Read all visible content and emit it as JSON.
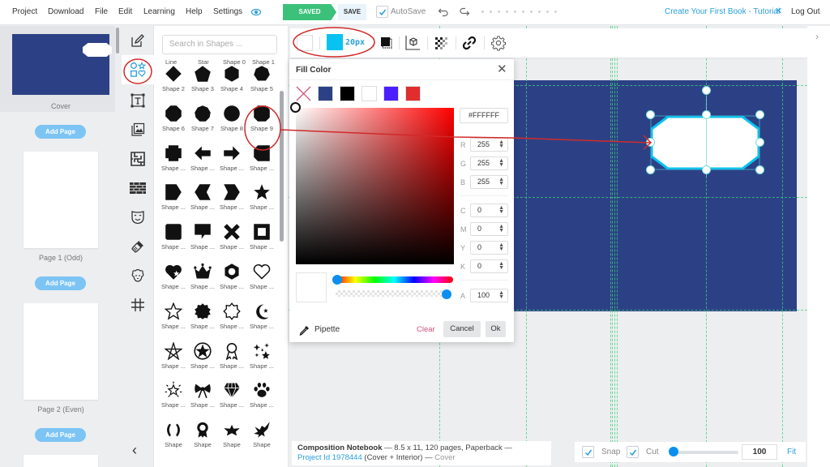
{
  "menu": {
    "items": [
      "Project",
      "Download",
      "File",
      "Edit",
      "Learning",
      "Help",
      "Settings"
    ],
    "saved_label": "SAVED",
    "save_label": "SAVE",
    "autosave_label": "AutoSave",
    "autosave_checked": true,
    "tutorial_label": "Create Your First Book - Tutorial",
    "logout_label": "Log Out"
  },
  "pages": {
    "items": [
      {
        "label": "Cover",
        "selected": true
      },
      {
        "label": "Page 1 (Odd)"
      },
      {
        "label": "Page 2 (Even)"
      }
    ],
    "add_page_label": "Add Page"
  },
  "tools": {
    "items": [
      "edit-icon",
      "shapes-icon",
      "text-icon",
      "images-icon",
      "puzzles-icon",
      "patterns-icon",
      "masks-icon",
      "brush-icon",
      "sheep-icon",
      "grid-icon"
    ],
    "active": "shapes-icon"
  },
  "shapes_panel": {
    "search_placeholder": "Search in Shapes ...",
    "partial_top_labels": [
      "Line",
      "Star",
      "Shape 0",
      "Shape 1"
    ],
    "items": [
      {
        "label": "Shape 2",
        "icon": "diamond"
      },
      {
        "label": "Shape 3",
        "icon": "pentagon"
      },
      {
        "label": "Shape 4",
        "icon": "hexagon"
      },
      {
        "label": "Shape 5",
        "icon": "heptagon"
      },
      {
        "label": "Shape 6",
        "icon": "octagon"
      },
      {
        "label": "Shape 7",
        "icon": "nonagon"
      },
      {
        "label": "Shape 8",
        "icon": "decagon"
      },
      {
        "label": "Shape 9",
        "icon": "rounded-octagon",
        "highlighted": true
      },
      {
        "label": "Shape ...",
        "icon": "cross-square"
      },
      {
        "label": "Shape ...",
        "icon": "arrow-left"
      },
      {
        "label": "Shape ...",
        "icon": "arrow-right"
      },
      {
        "label": "Shape ...",
        "icon": "cut-rect-left"
      },
      {
        "label": "Shape ...",
        "icon": "tag-right"
      },
      {
        "label": "Shape ...",
        "icon": "chevron-left"
      },
      {
        "label": "Shape ...",
        "icon": "chevron-right"
      },
      {
        "label": "Shape ...",
        "icon": "star-solid"
      },
      {
        "label": "Shape ...",
        "icon": "rounded-square"
      },
      {
        "label": "Shape ...",
        "icon": "speech-bubble"
      },
      {
        "label": "Shape ...",
        "icon": "x-cross"
      },
      {
        "label": "Shape ...",
        "icon": "square-frame"
      },
      {
        "label": "Shape ...",
        "icon": "heart-star"
      },
      {
        "label": "Shape ...",
        "icon": "crown"
      },
      {
        "label": "Shape ...",
        "icon": "hex-nut"
      },
      {
        "label": "Shape ...",
        "icon": "heart-outline"
      },
      {
        "label": "Shape ...",
        "icon": "star-outline"
      },
      {
        "label": "Shape ...",
        "icon": "seal"
      },
      {
        "label": "Shape ...",
        "icon": "seal-outline"
      },
      {
        "label": "Shape ...",
        "icon": "crescent-star"
      },
      {
        "label": "Shape ...",
        "icon": "pentagram"
      },
      {
        "label": "Shape ...",
        "icon": "star-badge"
      },
      {
        "label": "Shape ...",
        "icon": "ribbon-award"
      },
      {
        "label": "Shape ...",
        "icon": "sparkles"
      },
      {
        "label": "Shape ...",
        "icon": "star-burst"
      },
      {
        "label": "Shape ...",
        "icon": "bow"
      },
      {
        "label": "Shape ...",
        "icon": "diamond-gem"
      },
      {
        "label": "Shape ...",
        "icon": "paw"
      },
      {
        "label": "Shape",
        "icon": "laurel"
      },
      {
        "label": "Shape",
        "icon": "rosette"
      },
      {
        "label": "Shape",
        "icon": "winged-star"
      },
      {
        "label": "Shape",
        "icon": "eagle"
      }
    ]
  },
  "toolbar": {
    "fill_color": "#FFFFFF",
    "stroke_color": "#08C2F2",
    "stroke_width": "20px",
    "icons": [
      "shadow-icon",
      "3d-box-icon",
      "transparency-icon",
      "link-icon",
      "settings-icon"
    ]
  },
  "fill_color_popup": {
    "title": "Fill Color",
    "swatches": [
      "none",
      "#2C4185",
      "#000000",
      "#FFFFFF",
      "#4B1EFF",
      "#E02D2D"
    ],
    "hex": "#FFFFFF",
    "rgb": {
      "R": "255",
      "G": "255",
      "B": "255"
    },
    "cmyk": {
      "C": "0",
      "M": "0",
      "Y": "0",
      "K": "0"
    },
    "alpha_label": "A",
    "alpha": "100",
    "hue_base": "#FF0000",
    "pipette_label": "Pipette",
    "clear_label": "Clear",
    "cancel_label": "Cancel",
    "ok_label": "Ok"
  },
  "canvas": {
    "cover_color": "#2C4185",
    "selected_shape": {
      "name": "Shape 9",
      "fill": "#FFFFFF",
      "stroke": "#08C2F2"
    }
  },
  "footer": {
    "title": "Composition Notebook",
    "details": " — 8.5 x 11, 120 pages, Paperback —",
    "project_link": "Project Id 1978444",
    "scope": " (Cover + Interior) — ",
    "current": "Cover"
  },
  "zoom": {
    "snap_label": "Snap",
    "snap_checked": true,
    "cut_label": "Cut",
    "cut_checked": true,
    "value": "100",
    "fit_label": "Fit"
  },
  "colors": {
    "accent": "#2A9FD8",
    "saved_green": "#3CC17A",
    "annotation_red": "#D22A2A",
    "guide_green": "#3CD27A"
  }
}
